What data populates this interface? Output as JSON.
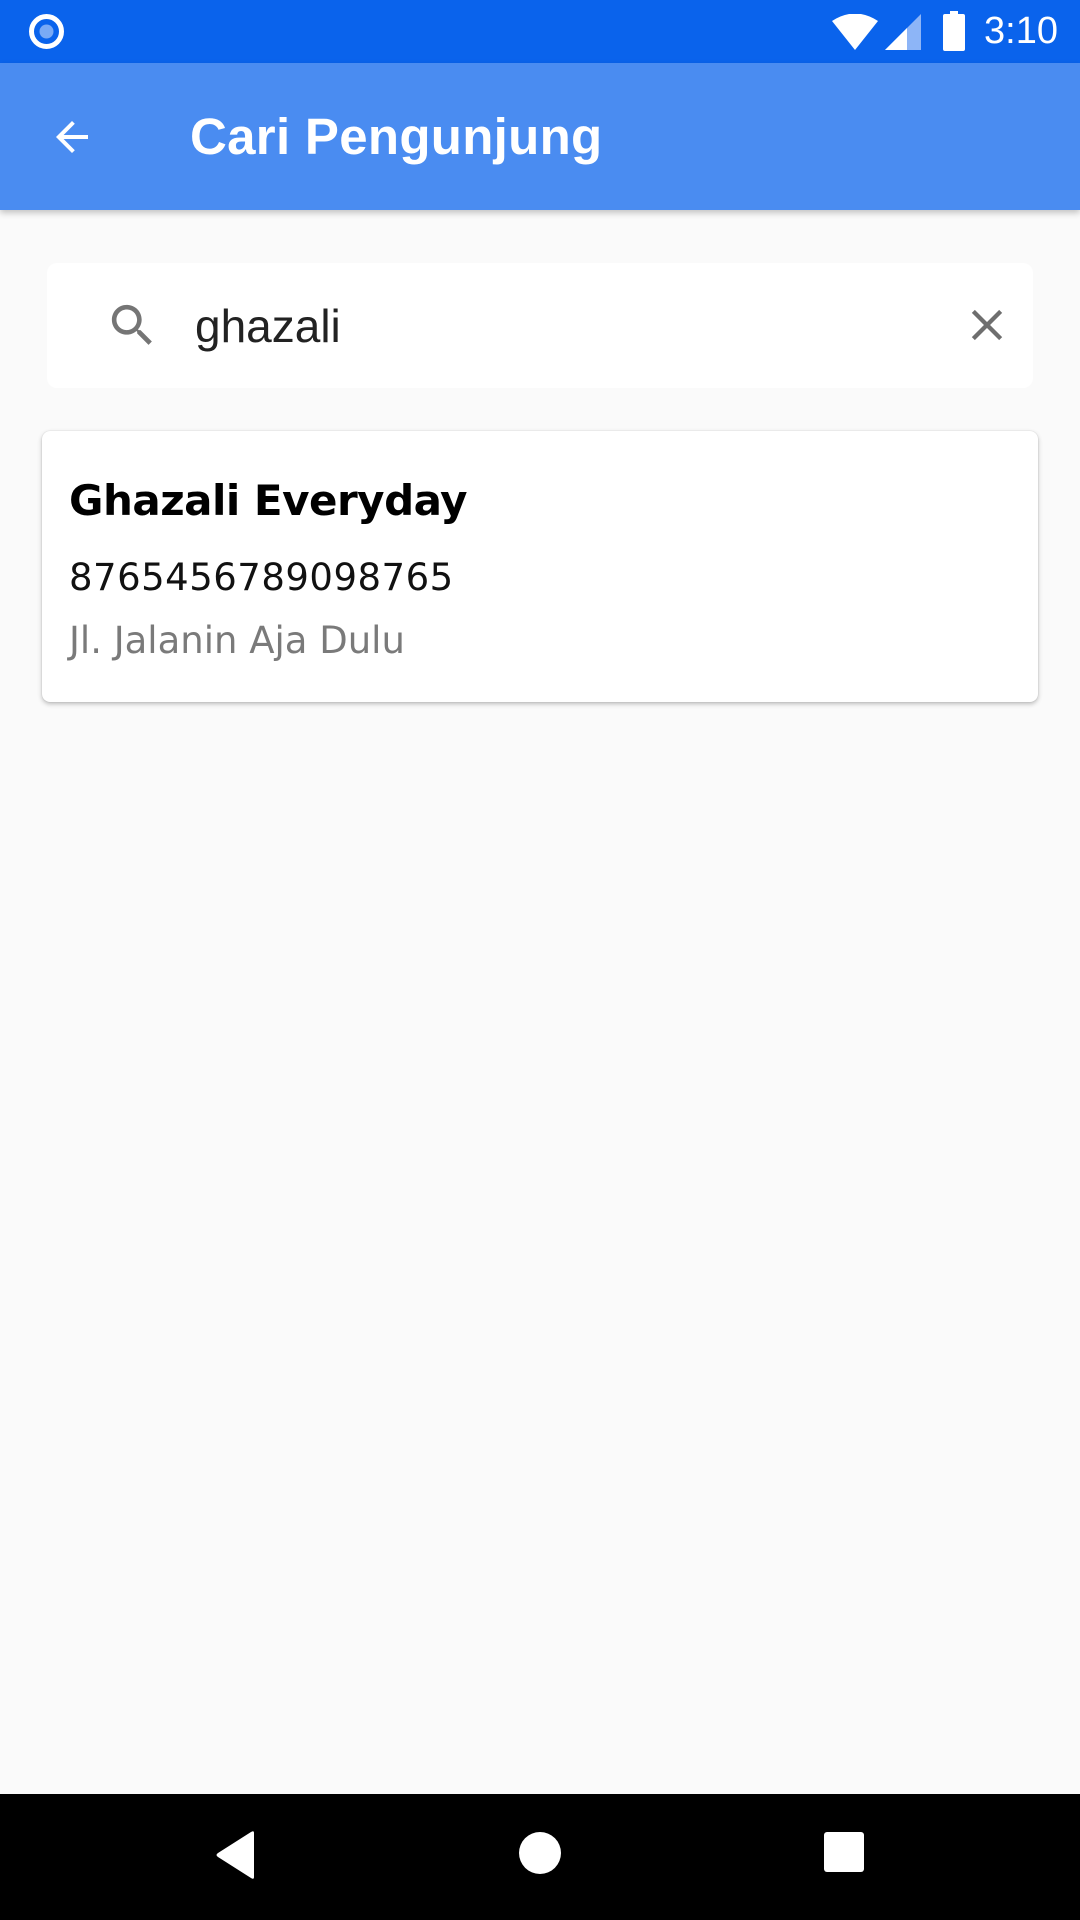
{
  "status_bar": {
    "time": "3:10",
    "icons": [
      "app-indicator-icon",
      "wifi-icon",
      "signal-icon",
      "battery-icon"
    ]
  },
  "app_bar": {
    "title": "Cari Pengunjung",
    "back_icon": "arrow-back-icon"
  },
  "search": {
    "value": "ghazali",
    "search_icon": "search-icon",
    "clear_icon": "close-icon"
  },
  "results": [
    {
      "name": "Ghazali Everyday",
      "phone": "8765456789098765",
      "address": "Jl. Jalanin Aja Dulu"
    }
  ],
  "nav_bar": {
    "icons": [
      "nav-back-icon",
      "nav-home-icon",
      "nav-recents-icon"
    ]
  },
  "colors": {
    "status_bar": "#0a63ec",
    "app_bar": "#4a8cf1",
    "background": "#fafafa",
    "card": "#ffffff",
    "secondary_text": "#7a7a7a"
  }
}
